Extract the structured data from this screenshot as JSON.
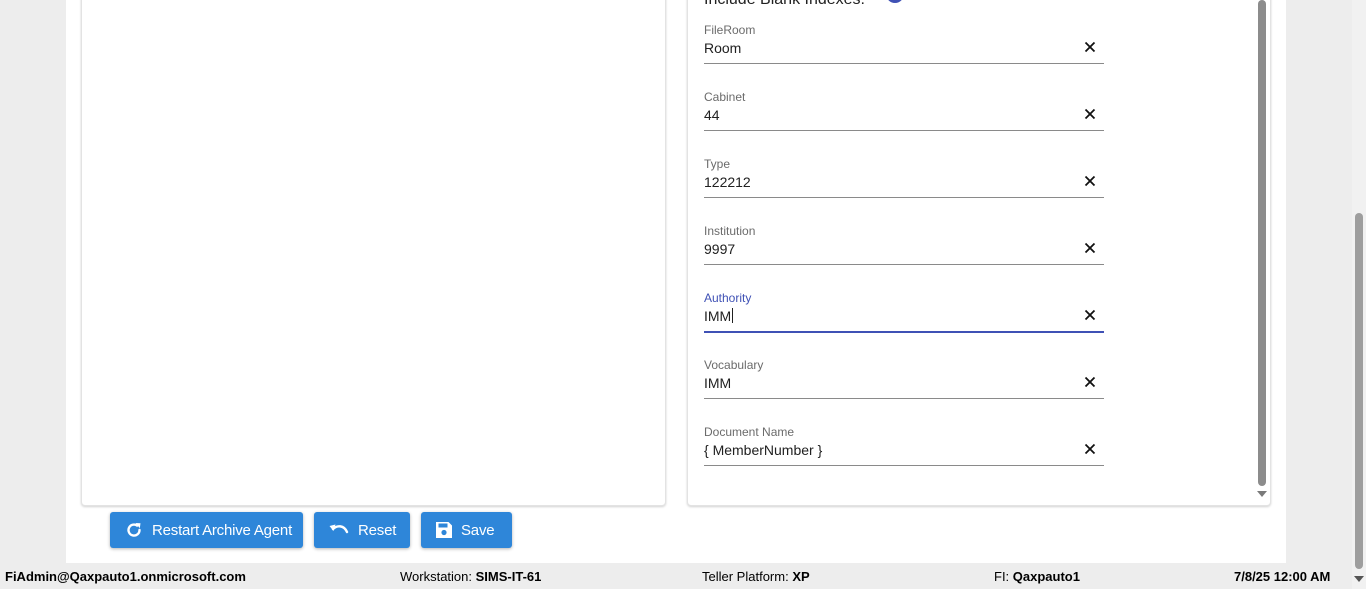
{
  "form": {
    "include_blank_label": "Include Blank Indexes:",
    "fields": [
      {
        "label": "FileRoom",
        "value": "Room"
      },
      {
        "label": "Cabinet",
        "value": "44"
      },
      {
        "label": "Type",
        "value": "122212"
      },
      {
        "label": "Institution",
        "value": "9997"
      },
      {
        "label": "Authority",
        "value": "IMM"
      },
      {
        "label": "Vocabulary",
        "value": "IMM"
      },
      {
        "label": "Document Name",
        "value": "{ MemberNumber }"
      }
    ]
  },
  "actions": {
    "restart_label": "Restart Archive Agent",
    "reset_label": "Reset",
    "save_label": "Save"
  },
  "status_bar": {
    "user": "FiAdmin@Qaxpauto1.onmicrosoft.com",
    "workstation_label": "Workstation:",
    "workstation_value": "SIMS-IT-61",
    "platform_label": "Teller Platform:",
    "platform_value": "XP",
    "fi_label": "FI:",
    "fi_value": "Qaxpauto1",
    "datetime": "7/8/25 12:00 AM"
  },
  "colors": {
    "accent": "#3f51b5",
    "button": "#2e86d9"
  },
  "icons": [
    "clear-icon",
    "restart-icon",
    "undo-icon",
    "save-icon"
  ]
}
